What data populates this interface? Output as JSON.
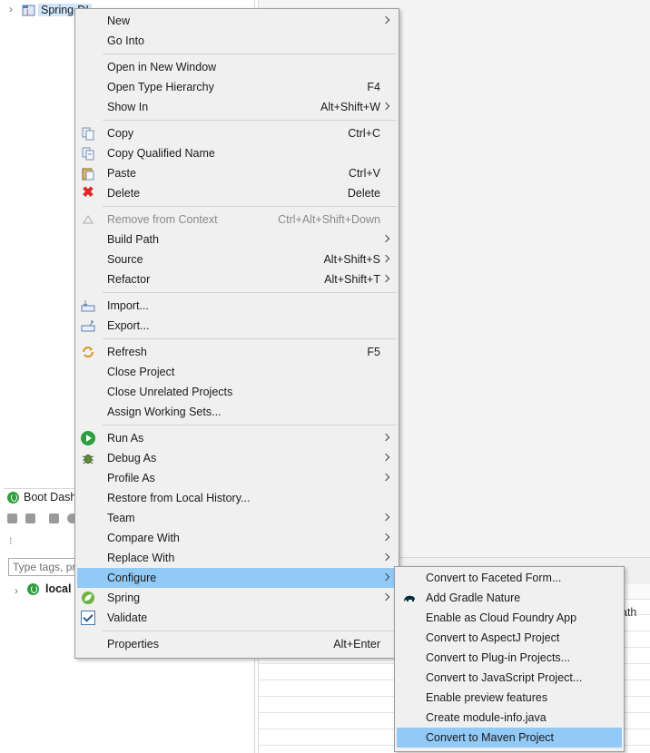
{
  "tree": {
    "project_label": "Spring-DI"
  },
  "boot_dashboard": {
    "title": "Boot Dash",
    "filter_placeholder": "Type tags, pr",
    "local_label": "local"
  },
  "right_panel": {
    "partial_text": "ath"
  },
  "context_menu": {
    "new": {
      "label": "New",
      "shortcut": ""
    },
    "go_into": {
      "label": "Go Into",
      "shortcut": ""
    },
    "open_new_window": {
      "label": "Open in New Window",
      "shortcut": ""
    },
    "open_type_hierarchy": {
      "label": "Open Type Hierarchy",
      "shortcut": "F4"
    },
    "show_in": {
      "label": "Show In",
      "shortcut": "Alt+Shift+W"
    },
    "copy": {
      "label": "Copy",
      "shortcut": "Ctrl+C"
    },
    "copy_qualified": {
      "label": "Copy Qualified Name",
      "shortcut": ""
    },
    "paste": {
      "label": "Paste",
      "shortcut": "Ctrl+V"
    },
    "delete": {
      "label": "Delete",
      "shortcut": "Delete"
    },
    "remove_context": {
      "label": "Remove from Context",
      "shortcut": "Ctrl+Alt+Shift+Down"
    },
    "build_path": {
      "label": "Build Path",
      "shortcut": ""
    },
    "source": {
      "label": "Source",
      "shortcut": "Alt+Shift+S"
    },
    "refactor": {
      "label": "Refactor",
      "shortcut": "Alt+Shift+T"
    },
    "import": {
      "label": "Import...",
      "shortcut": ""
    },
    "export": {
      "label": "Export...",
      "shortcut": ""
    },
    "refresh": {
      "label": "Refresh",
      "shortcut": "F5"
    },
    "close_project": {
      "label": "Close Project",
      "shortcut": ""
    },
    "close_unrelated": {
      "label": "Close Unrelated Projects",
      "shortcut": ""
    },
    "assign_sets": {
      "label": "Assign Working Sets...",
      "shortcut": ""
    },
    "run_as": {
      "label": "Run As",
      "shortcut": ""
    },
    "debug_as": {
      "label": "Debug As",
      "shortcut": ""
    },
    "profile_as": {
      "label": "Profile As",
      "shortcut": ""
    },
    "restore_history": {
      "label": "Restore from Local History...",
      "shortcut": ""
    },
    "team": {
      "label": "Team",
      "shortcut": ""
    },
    "compare_with": {
      "label": "Compare With",
      "shortcut": ""
    },
    "replace_with": {
      "label": "Replace With",
      "shortcut": ""
    },
    "configure": {
      "label": "Configure",
      "shortcut": ""
    },
    "spring": {
      "label": "Spring",
      "shortcut": ""
    },
    "validate": {
      "label": "Validate",
      "shortcut": ""
    },
    "properties": {
      "label": "Properties",
      "shortcut": "Alt+Enter"
    }
  },
  "configure_submenu": {
    "faceted_form": "Convert to Faceted Form...",
    "gradle_nature": "Add Gradle Nature",
    "cloud_foundry": "Enable as Cloud Foundry App",
    "aspectj": "Convert to AspectJ Project",
    "plugin_projects": "Convert to Plug-in Projects...",
    "javascript_project": "Convert to JavaScript Project...",
    "preview_features": "Enable preview features",
    "module_info": "Create module-info.java",
    "maven_project": "Convert to Maven Project"
  },
  "colors": {
    "highlight": "#91c9f7",
    "menu_bg": "#f0f0f0",
    "spring_green": "#2f9e41",
    "delete_red": "#e0262a"
  }
}
